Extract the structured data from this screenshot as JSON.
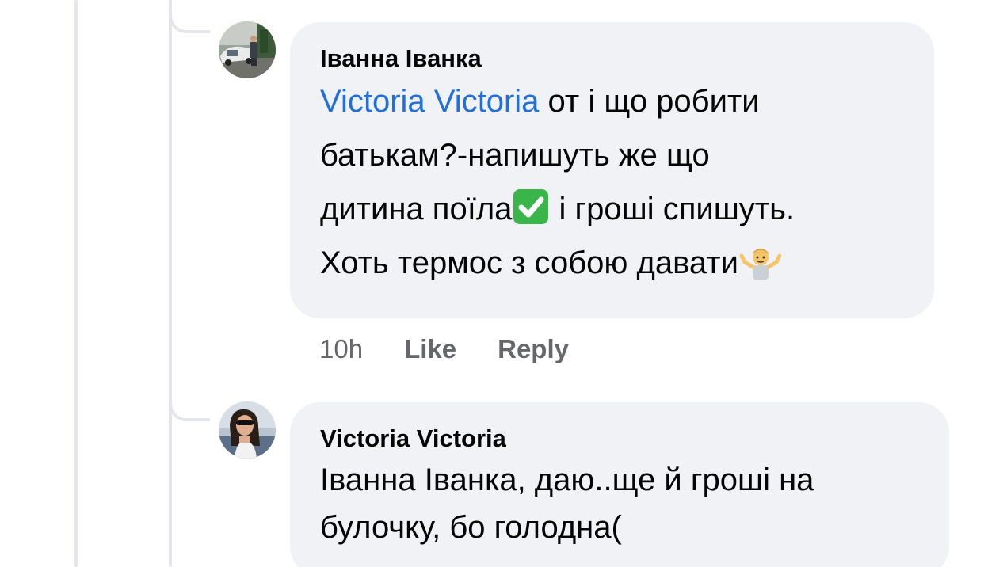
{
  "comments": [
    {
      "author": "Іванна Іванка",
      "mention": "Victoria Victoria",
      "line1_rest": " от і що робити",
      "line2": "батькам?-напишуть же що",
      "line3_before": "дитина поїла",
      "line3_after": " і гроші спишуть.",
      "line4": "Хоть термос з собою давати",
      "emoji_check": "check-mark-emoji",
      "emoji_shrug": "person-shrugging-emoji",
      "avatar": "avatar-photo",
      "time": "10h",
      "like_label": "Like",
      "reply_label": "Reply"
    },
    {
      "author": "Victoria Victoria",
      "line1": "Іванна Іванка, даю..ще й гроші на",
      "line2": "булочку, бо голодна(",
      "avatar": "avatar-photo"
    }
  ],
  "colors": {
    "bubble": "#f0f2f5",
    "mention": "#216fdb",
    "meta_text": "#65676b",
    "thread_line": "#e4e6eb",
    "check_emoji": "#3ab54a"
  }
}
